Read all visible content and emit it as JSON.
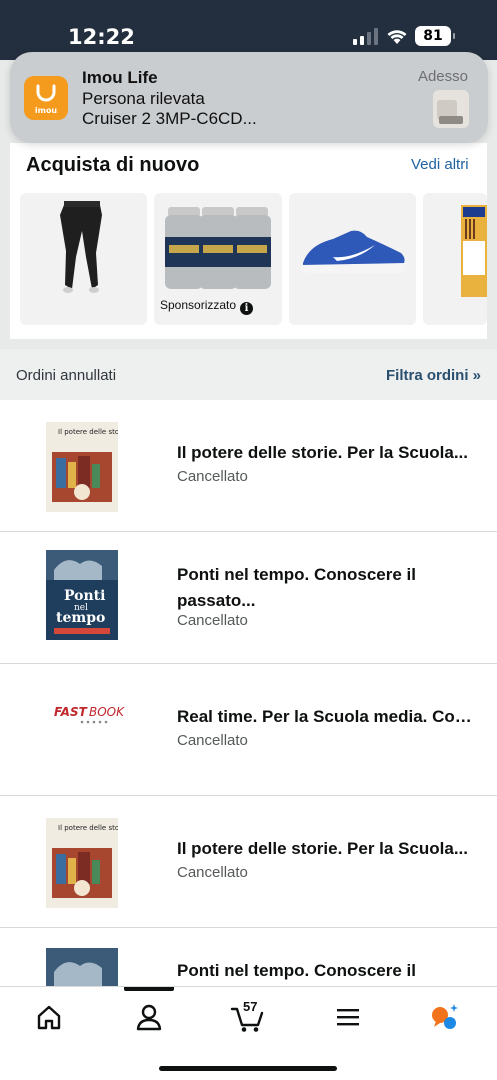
{
  "status_bar": {
    "time": "12:22",
    "battery": "81"
  },
  "notification": {
    "app_name": "Imou Life",
    "app_icon_text": "imou",
    "line1": "Persona rilevata",
    "line2": "Cruiser 2 3MP-C6CD...",
    "time": "Adesso"
  },
  "buy_again": {
    "title": "Acquista di nuovo",
    "see_more": "Vedi altri",
    "sponsored_label": "Sponsorizzato",
    "items": [
      {
        "icon": "black-cargo-pants-image"
      },
      {
        "icon": "three-bottles-image",
        "sponsored": true
      },
      {
        "icon": "blue-sneaker-image"
      },
      {
        "icon": "pens-pack-image"
      }
    ]
  },
  "orders_header": {
    "title": "Ordini annullati",
    "filter": "Filtra ordini »"
  },
  "orders": [
    {
      "title": "Il potere delle storie. Per la Scuola...",
      "status": "Cancellato",
      "cover": "storie"
    },
    {
      "title": "Ponti nel tempo. Conoscere il passato...",
      "status": "Cancellato",
      "cover": "ponti"
    },
    {
      "title": "Real time. Per la Scuola media. Con...",
      "status": "Cancellato",
      "cover": "fastbook"
    },
    {
      "title": "Il potere delle storie. Per la Scuola...",
      "status": "Cancellato",
      "cover": "storie"
    },
    {
      "title": "Ponti nel tempo. Conoscere il",
      "status": "",
      "cover": "ponti"
    }
  ],
  "covers": {
    "storie_title": "Il potere delle storie",
    "ponti_title_1": "Ponti",
    "ponti_title_2": "nel",
    "ponti_title_3": "tempo",
    "fastbook_fast": "FAST",
    "fastbook_book": "BOOK"
  },
  "bottom_nav": {
    "cart_count": "57",
    "items": [
      "home-icon",
      "account-icon",
      "cart-icon",
      "menu-icon",
      "rufus-ai-icon"
    ]
  },
  "colors": {
    "header_bg": "#232f3e",
    "link_blue": "#2162a1",
    "imou_orange": "#f49b1d"
  }
}
